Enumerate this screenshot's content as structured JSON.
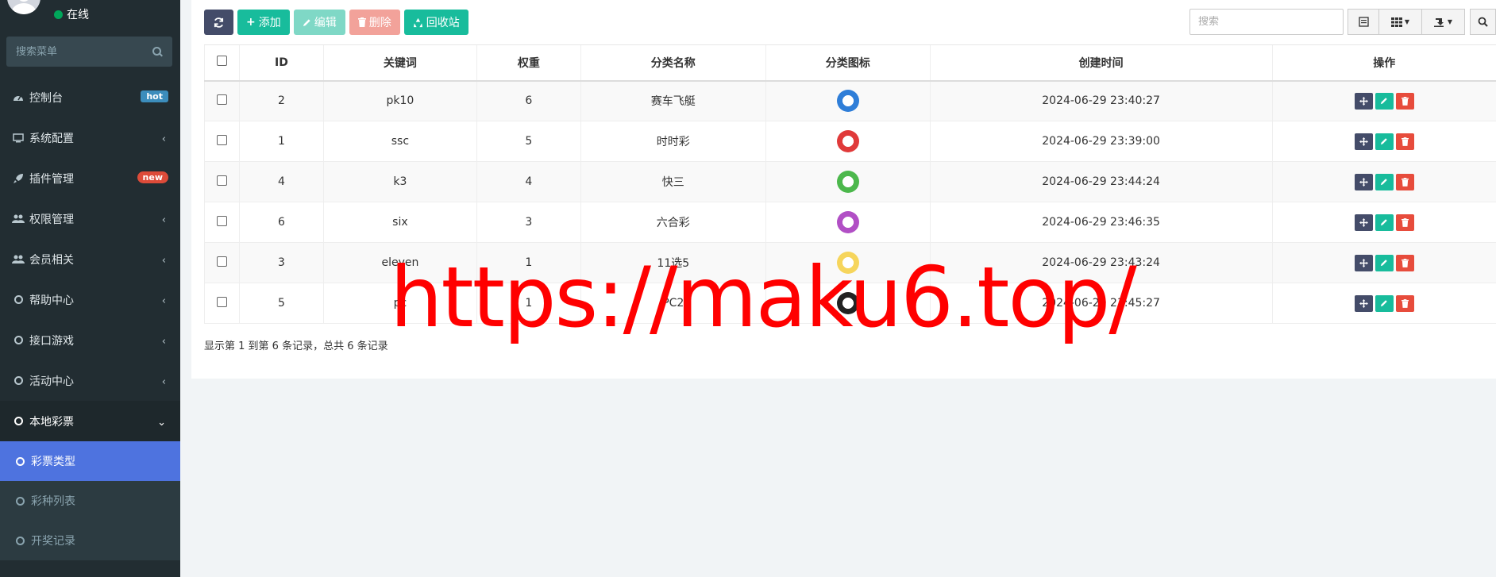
{
  "sidebar": {
    "status_text": "在线",
    "search_placeholder": "搜索菜单",
    "items": [
      {
        "label": "控制台",
        "badge": "hot",
        "icon": "dashboard-icon"
      },
      {
        "label": "系统配置",
        "icon": "monitor-icon"
      },
      {
        "label": "插件管理",
        "badge": "new",
        "icon": "rocket-icon"
      },
      {
        "label": "权限管理",
        "icon": "users-icon"
      },
      {
        "label": "会员相关",
        "icon": "users-icon"
      },
      {
        "label": "帮助中心",
        "icon": "circle-icon"
      },
      {
        "label": "接口游戏",
        "icon": "circle-icon"
      },
      {
        "label": "活动中心",
        "icon": "circle-icon"
      },
      {
        "label": "本地彩票",
        "icon": "circle-icon"
      }
    ],
    "subitems": [
      {
        "label": "彩票类型"
      },
      {
        "label": "彩种列表"
      },
      {
        "label": "开奖记录"
      }
    ]
  },
  "toolbar": {
    "add_label": "添加",
    "edit_label": "编辑",
    "delete_label": "删除",
    "recycle_label": "回收站",
    "search_placeholder": "搜索"
  },
  "table": {
    "headers": [
      "ID",
      "关键词",
      "权重",
      "分类名称",
      "分类图标",
      "创建时间",
      "操作"
    ],
    "rows": [
      {
        "id": "2",
        "keyword": "pk10",
        "weight": "6",
        "name": "赛车飞艇",
        "icon_color": "#2f7ed8",
        "created": "2024-06-29 23:40:27"
      },
      {
        "id": "1",
        "keyword": "ssc",
        "weight": "5",
        "name": "时时彩",
        "icon_color": "#e03a3a",
        "created": "2024-06-29 23:39:00"
      },
      {
        "id": "4",
        "keyword": "k3",
        "weight": "4",
        "name": "快三",
        "icon_color": "#4cb84c",
        "created": "2024-06-29 23:44:24"
      },
      {
        "id": "6",
        "keyword": "six",
        "weight": "3",
        "name": "六合彩",
        "icon_color": "#b14fc5",
        "created": "2024-06-29 23:46:35"
      },
      {
        "id": "3",
        "keyword": "eleven",
        "weight": "1",
        "name": "11选5",
        "icon_color": "#f6d55c",
        "created": "2024-06-29 23:43:24"
      },
      {
        "id": "5",
        "keyword": "pc",
        "weight": "1",
        "name": "PC2",
        "icon_color": "#222222",
        "created": "2024-06-29 23:45:27"
      }
    ]
  },
  "footer": {
    "summary": "显示第 1 到第 6 条记录，总共 6 条记录"
  },
  "watermark": "https://maku6.top/"
}
